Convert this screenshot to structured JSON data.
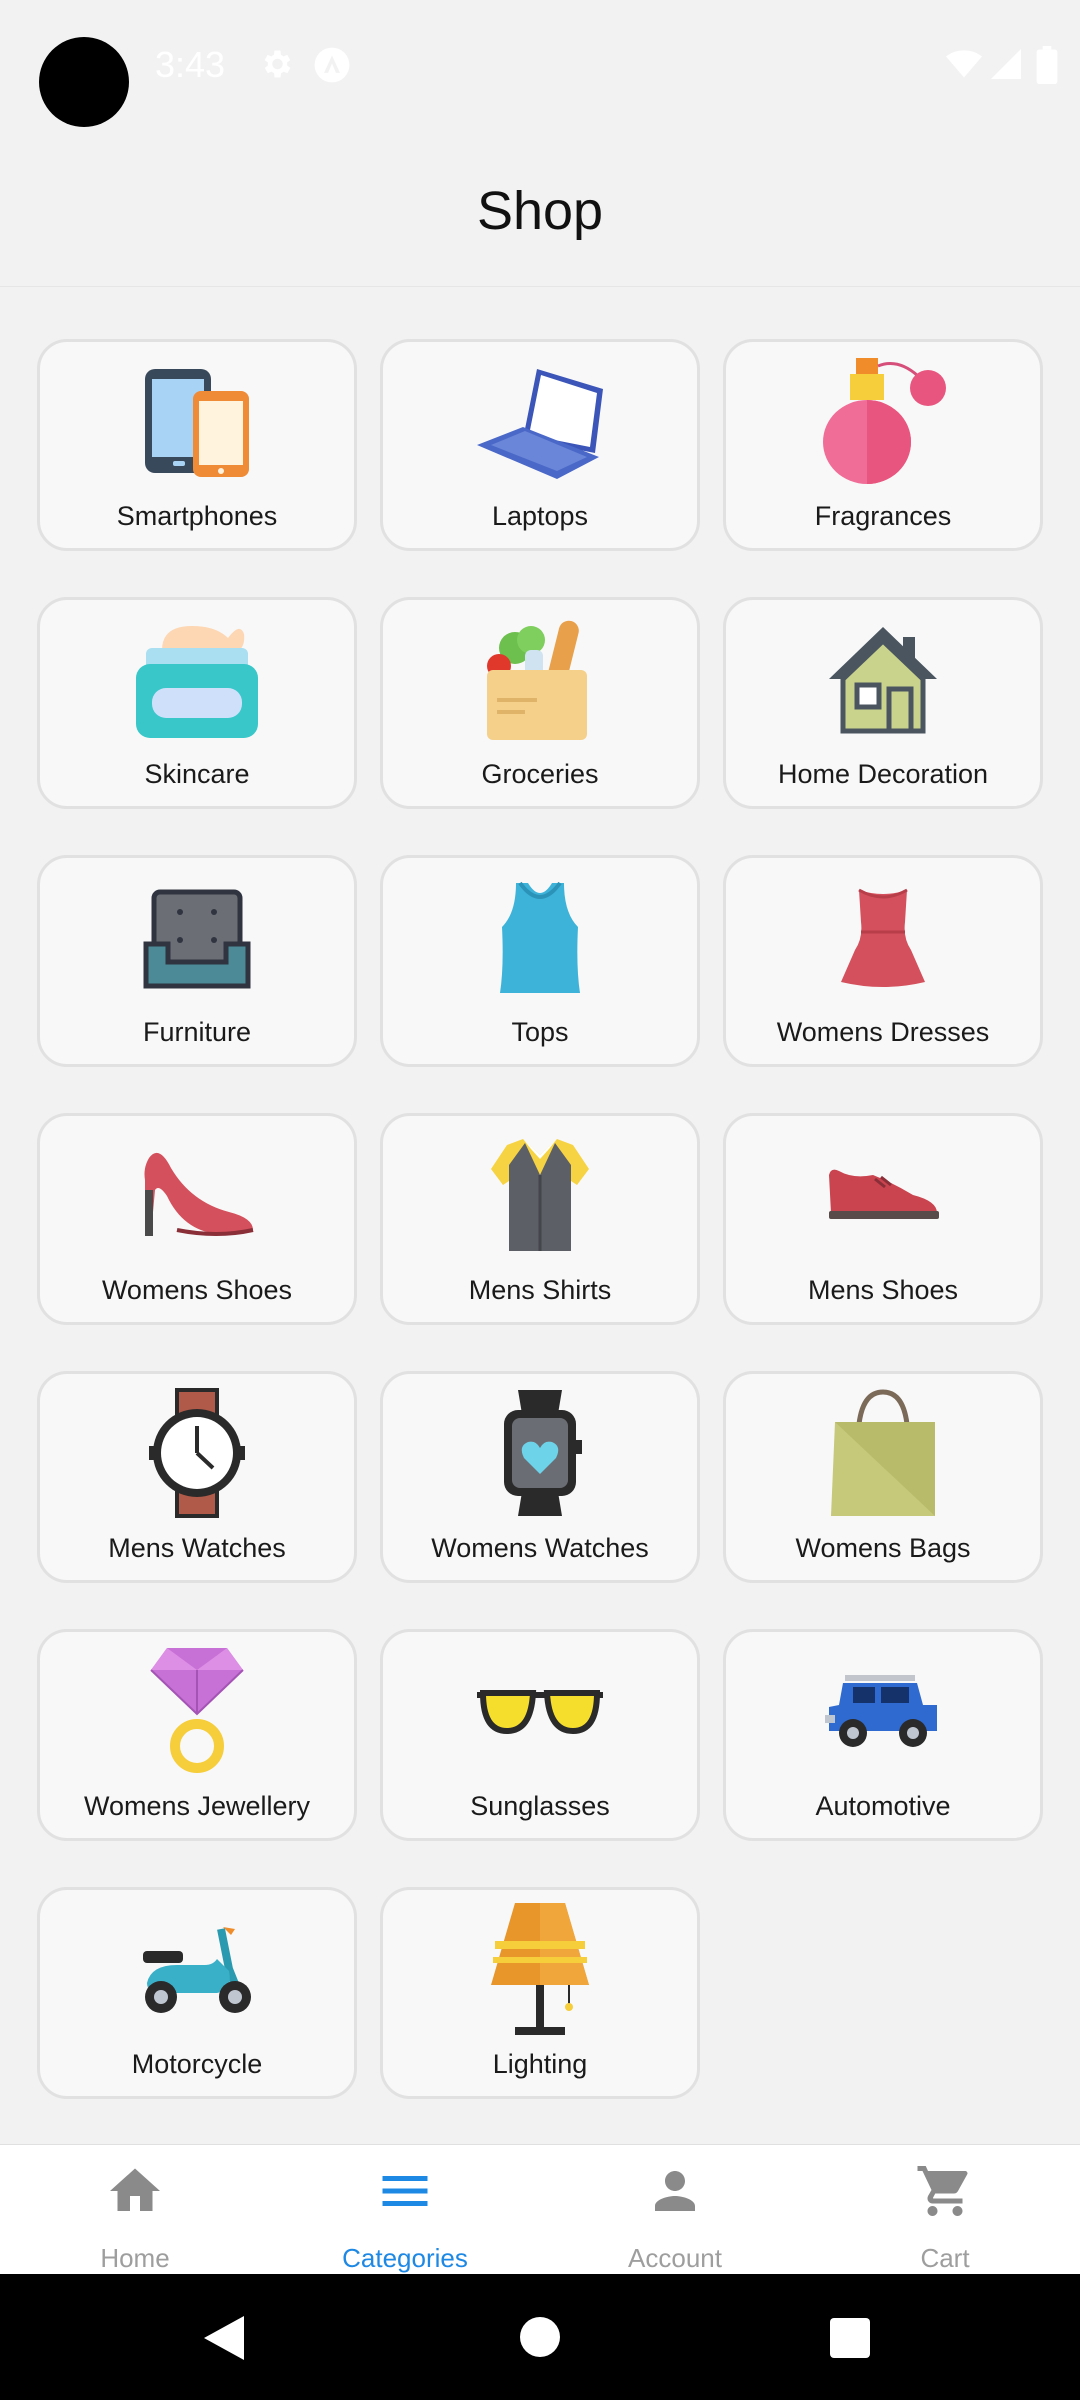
{
  "status": {
    "time": "3:43"
  },
  "header": {
    "title": "Shop"
  },
  "categories": [
    {
      "label": "Smartphones",
      "icon": "smartphone-icon"
    },
    {
      "label": "Laptops",
      "icon": "laptop-icon"
    },
    {
      "label": "Fragrances",
      "icon": "perfume-icon"
    },
    {
      "label": "Skincare",
      "icon": "cream-jar-icon"
    },
    {
      "label": "Groceries",
      "icon": "grocery-bag-icon"
    },
    {
      "label": "Home Decoration",
      "icon": "house-icon"
    },
    {
      "label": "Furniture",
      "icon": "armchair-icon"
    },
    {
      "label": "Tops",
      "icon": "tank-top-icon"
    },
    {
      "label": "Womens Dresses",
      "icon": "dress-icon"
    },
    {
      "label": "Womens Shoes",
      "icon": "high-heel-icon"
    },
    {
      "label": "Mens Shirts",
      "icon": "shirt-vest-icon"
    },
    {
      "label": "Mens Shoes",
      "icon": "mens-shoe-icon"
    },
    {
      "label": "Mens Watches",
      "icon": "wristwatch-icon"
    },
    {
      "label": "Womens Watches",
      "icon": "smartwatch-icon"
    },
    {
      "label": "Womens Bags",
      "icon": "shopping-bag-icon"
    },
    {
      "label": "Womens Jewellery",
      "icon": "diamond-ring-icon"
    },
    {
      "label": "Sunglasses",
      "icon": "sunglasses-icon"
    },
    {
      "label": "Automotive",
      "icon": "jeep-icon"
    },
    {
      "label": "Motorcycle",
      "icon": "scooter-icon"
    },
    {
      "label": "Lighting",
      "icon": "floor-lamp-icon"
    }
  ],
  "nav": {
    "tabs": [
      {
        "label": "Home",
        "icon": "home-icon"
      },
      {
        "label": "Categories",
        "icon": "menu-icon",
        "active": true
      },
      {
        "label": "Account",
        "icon": "person-icon"
      },
      {
        "label": "Cart",
        "icon": "cart-icon"
      }
    ],
    "active_color": "#1e88e5",
    "inactive_color": "#9e9e9e"
  }
}
